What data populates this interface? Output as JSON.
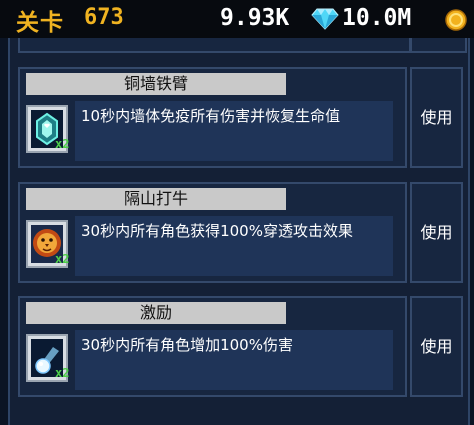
{
  "header": {
    "level_label": "关卡",
    "level_number": "673",
    "gems": "9.93K",
    "coins": "10.0M",
    "gem_icon": "diamond-icon",
    "coin_icon": "gold-coin-icon"
  },
  "items": [
    {
      "title": "铜墙铁臂",
      "description": "10秒内墙体免疫所有伤害并恢复生命值",
      "count": "x2",
      "icon": "shield-crystal-icon",
      "use_label": "使用"
    },
    {
      "title": "隔山打牛",
      "description": "30秒内所有角色获得100%穿透攻击效果",
      "count": "x2",
      "icon": "lion-icon",
      "use_label": "使用"
    },
    {
      "title": "激励",
      "description": "30秒内所有角色增加100%伤害",
      "count": "x2",
      "icon": "comet-icon",
      "use_label": "使用"
    }
  ],
  "colors": {
    "accent": "#f0b321",
    "count_green": "#4ecf4a",
    "panel": "#172640"
  }
}
